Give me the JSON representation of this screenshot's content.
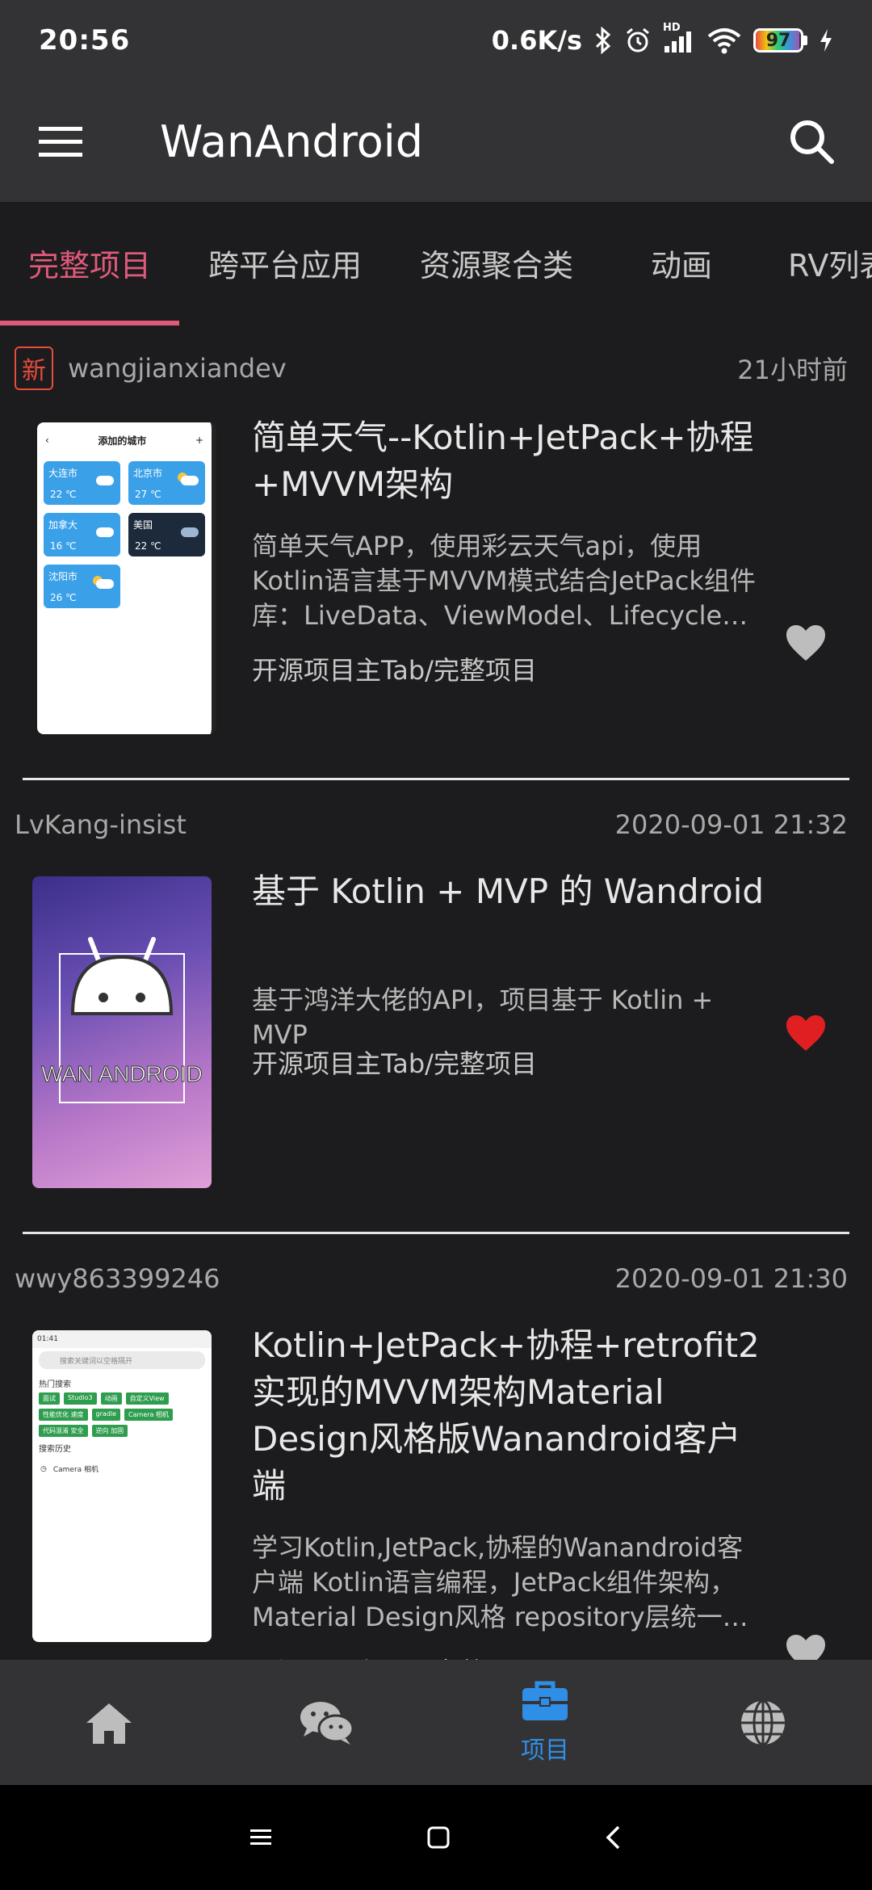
{
  "status_bar": {
    "time": "20:56",
    "network_speed": "0.6K/s",
    "signal_label": "HD",
    "battery_level": "97",
    "battery_fraction": 0.97
  },
  "app_bar": {
    "title": "WanAndroid",
    "menu_icon": "hamburger-menu-icon",
    "search_icon": "search-icon"
  },
  "tabs": {
    "items": [
      "完整项目",
      "跨平台应用",
      "资源聚合类",
      "动画",
      "RV列表"
    ],
    "active_index": 0,
    "active_color": "#e05a7a"
  },
  "articles": [
    {
      "is_new": true,
      "new_badge": "新",
      "author": "wangjianxiandev",
      "date": "21小时前",
      "title": "简单天气--Kotlin+JetPack+协程+MVVM架构",
      "desc": "简单天气APP，使用彩云天气api，使用Kotlin语言基于MVVM模式结合JetPack组件库：LiveData、ViewModel、Lifecycle、Navigation、Room",
      "chapter": "开源项目主Tab/完整项目",
      "collected": false,
      "thumb": {
        "header": "添加的城市",
        "cities": [
          {
            "name": "大连市",
            "temp": "22 ℃"
          },
          {
            "name": "北京市",
            "temp": "27 ℃"
          },
          {
            "name": "加拿大",
            "temp": "16 ℃"
          },
          {
            "name": "美国",
            "temp": "22 ℃"
          },
          {
            "name": "沈阳市",
            "temp": "26 ℃"
          }
        ]
      }
    },
    {
      "is_new": false,
      "author": "LvKang-insist",
      "date": "2020-09-01 21:32",
      "title": "基于 Kotlin + MVP 的 Wandroid",
      "desc": "基于鸿洋大佬的API，项目基于 Kotlin + MVP",
      "chapter": "开源项目主Tab/完整项目",
      "collected": true,
      "thumb": {
        "caption": "WAN ANDROID"
      }
    },
    {
      "is_new": false,
      "author": "wwy863399246",
      "date": "2020-09-01 21:30",
      "title": "Kotlin+JetPack+协程+retrofit2实现的MVVM架构Material Design风格版Wanandroid客户端",
      "desc": "学习Kotlin,JetPack,协程的Wanandroid客户端 Kotlin语言编程，JetPack组件架构，Material Design风格 repository层统一管理数据",
      "chapter": "开源项目主Tab/完整项目",
      "collected": false,
      "thumb": {
        "status_time": "01:41",
        "search_placeholder": "搜索关键词以空格隔开",
        "hot_label": "热门搜索",
        "tags": [
          "面试",
          "Studio3",
          "动画",
          "自定义View",
          "性能优化 速度",
          "gradle",
          "Camera 相机",
          "代码混淆 安全",
          "逆向 加固"
        ],
        "history_label": "搜索历史",
        "history_item": "Camera 相机"
      }
    }
  ],
  "bottom_nav": {
    "items": [
      {
        "icon": "home-icon",
        "label": ""
      },
      {
        "icon": "wechat-icon",
        "label": ""
      },
      {
        "icon": "project-briefcase-icon",
        "label": "项目"
      },
      {
        "icon": "globe-icon",
        "label": ""
      }
    ],
    "active_index": 2,
    "active_color": "#2f8fe6"
  },
  "system_nav": {
    "icons": [
      "recents-menu-icon",
      "home-square-icon",
      "back-chevron-icon"
    ]
  }
}
